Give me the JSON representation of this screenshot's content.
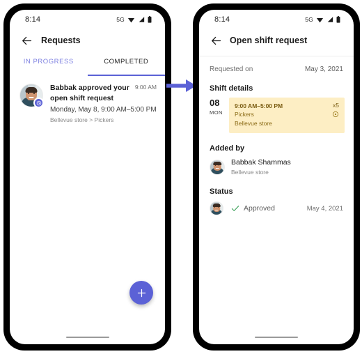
{
  "colors": {
    "accent": "#5b61d6",
    "tab_inactive": "#7b7ee0",
    "card_bg": "#fdeec4",
    "card_text": "#8a6a15",
    "approved_green": "#2e9a4e",
    "frame": "#000000"
  },
  "flow_arrow": {
    "icon": "arrow-right-icon",
    "color": "#5b61d6"
  },
  "left_phone": {
    "status_bar": {
      "time": "8:14",
      "network": "5G",
      "icons": [
        "wifi-icon",
        "signal-icon",
        "battery-icon"
      ]
    },
    "app_bar": {
      "back_icon": "back-arrow-icon",
      "title": "Requests"
    },
    "tabs": [
      {
        "label": "IN PROGRESS",
        "selected": false
      },
      {
        "label": "COMPLETED",
        "selected": true
      }
    ],
    "list": [
      {
        "avatar": "user-avatar",
        "badge_icon": "shift-badge-icon",
        "title": "Babbak approved your open shift request",
        "time": "9:00 AM",
        "subtitle": "Monday, May 8, 9:00 AM–5:00 PM",
        "meta": "Bellevue store > Pickers"
      }
    ],
    "fab": {
      "icon": "plus-icon",
      "label": "+"
    },
    "home_indicator": true
  },
  "right_phone": {
    "status_bar": {
      "time": "8:14",
      "network": "5G",
      "icons": [
        "wifi-icon",
        "signal-icon",
        "battery-icon"
      ]
    },
    "app_bar": {
      "back_icon": "back-arrow-icon",
      "title": "Open shift request"
    },
    "requested_on": {
      "label": "Requested on",
      "value": "May 3, 2021"
    },
    "shift_details": {
      "heading": "Shift details",
      "day_number": "08",
      "day_of_week": "MON",
      "time_range": "9:00 AM–5:00 PM",
      "role": "Pickers",
      "store": "Bellevue store",
      "count": "x5",
      "location_icon": "location-pin-icon"
    },
    "added_by": {
      "heading": "Added by",
      "avatar": "user-avatar",
      "name": "Babbak Shammas",
      "store": "Bellevue store"
    },
    "status": {
      "heading": "Status",
      "avatar": "user-avatar",
      "check_icon": "check-icon",
      "label": "Approved",
      "date": "May 4, 2021"
    },
    "home_indicator": true
  }
}
